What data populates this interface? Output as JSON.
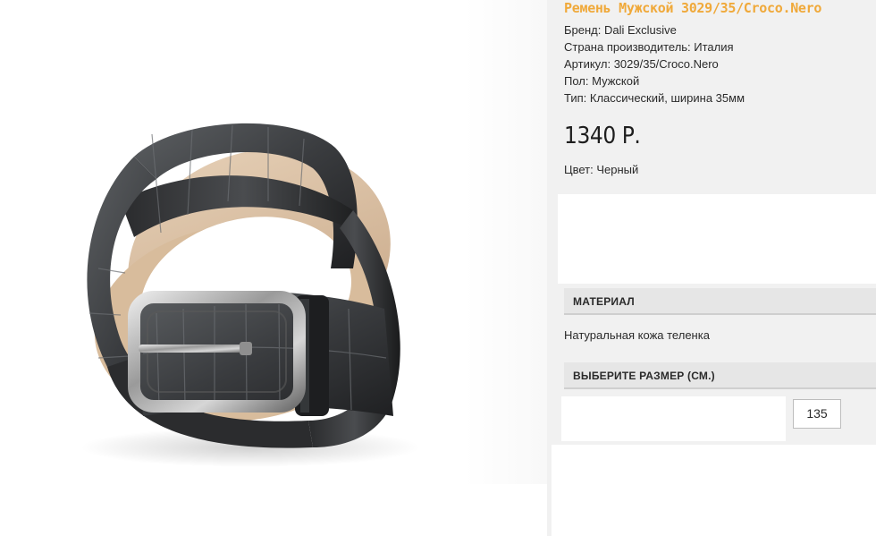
{
  "product": {
    "title": "Ремень Мужской 3029/35/Croco.Nero",
    "image_alt": "belt-image",
    "specs": [
      "Бренд: Dali Exclusive",
      "Страна производитель: Италия",
      "Артикул: 3029/35/Croco.Nero",
      "Пол: Мужской",
      "Тип: Классический, ширина 35мм"
    ],
    "price": "1340 Р.",
    "color_line": "Цвет: Черный"
  },
  "material": {
    "header": "МАТЕРИАЛ",
    "text": "Натуральная кожа теленка"
  },
  "size": {
    "header": "ВЫБЕРИТЕ РАЗМЕР (СМ.)",
    "options": [
      "135"
    ]
  },
  "colors": {
    "title": "#f0a93a",
    "panel": "#f1f1f1",
    "header": "#e6e6e6"
  }
}
